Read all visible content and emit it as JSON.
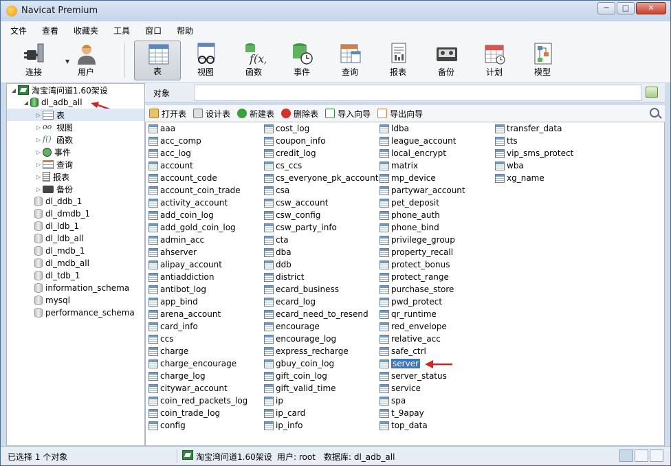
{
  "window": {
    "title": "Navicat Premium",
    "min": "─",
    "max": "□",
    "close": "✕"
  },
  "menu": [
    "文件",
    "查看",
    "收藏夹",
    "工具",
    "窗口",
    "帮助"
  ],
  "toolbar": {
    "connect": "连接",
    "user": "用户",
    "table": "表",
    "view": "视图",
    "function": "函数",
    "event": "事件",
    "query": "查询",
    "report": "报表",
    "backup": "备份",
    "schedule": "计划",
    "model": "模型"
  },
  "tree": {
    "connection": "淘宝湾问道1.60架设",
    "active_db": "dl_adb_all",
    "categories": [
      "表",
      "视图",
      "函数",
      "事件",
      "查询",
      "报表",
      "备份"
    ],
    "databases": [
      "dl_ddb_1",
      "dl_dmdb_1",
      "dl_ldb_1",
      "dl_ldb_all",
      "dl_mdb_1",
      "dl_mdb_all",
      "dl_tdb_1",
      "information_schema",
      "mysql",
      "performance_schema"
    ]
  },
  "objects_tab": "对象",
  "actions": [
    "打开表",
    "设计表",
    "新建表",
    "删除表",
    "导入向导",
    "导出向导"
  ],
  "tables": {
    "col1": [
      "aaa",
      "acc_comp",
      "acc_log",
      "account",
      "account_code",
      "account_coin_trade",
      "activity_account",
      "add_coin_log",
      "add_gold_coin_log",
      "admin_acc",
      "ahserver",
      "alipay_account",
      "antiaddiction",
      "antibot_log",
      "app_bind",
      "arena_account",
      "card_info",
      "ccs",
      "charge",
      "charge_encourage",
      "charge_log",
      "citywar_account",
      "coin_red_packets_log",
      "coin_trade_log",
      "config"
    ],
    "col2": [
      "cost_log",
      "coupon_info",
      "credit_log",
      "cs_ccs",
      "cs_everyone_pk_account",
      "csa",
      "csw_account",
      "csw_config",
      "csw_party_info",
      "cta",
      "dba",
      "ddb",
      "district",
      "ecard_business",
      "ecard_log",
      "ecard_need_to_resend",
      "encourage",
      "encourage_log",
      "express_recharge",
      "gbuy_coin_log",
      "gift_coin_log",
      "gift_valid_time",
      "ip",
      "ip_card",
      "ip_info"
    ],
    "col3": [
      "ldba",
      "league_account",
      "local_encrypt",
      "matrix",
      "mp_device",
      "partywar_account",
      "pet_deposit",
      "phone_auth",
      "phone_bind",
      "privilege_group",
      "property_recall",
      "protect_bonus",
      "protect_range",
      "purchase_store",
      "pwd_protect",
      "qr_runtime",
      "red_envelope",
      "relative_acc",
      "safe_ctrl",
      "server",
      "server_status",
      "service",
      "spa",
      "t_9apay",
      "top_data"
    ],
    "col4": [
      "transfer_data",
      "tts",
      "vip_sms_protect",
      "wba",
      "xg_name"
    ],
    "selected": "server"
  },
  "status": {
    "selection": "已选择 1 个对象",
    "connection": "淘宝湾问道1.60架设",
    "user": "用户: root",
    "database": "数据库: dl_adb_all"
  }
}
